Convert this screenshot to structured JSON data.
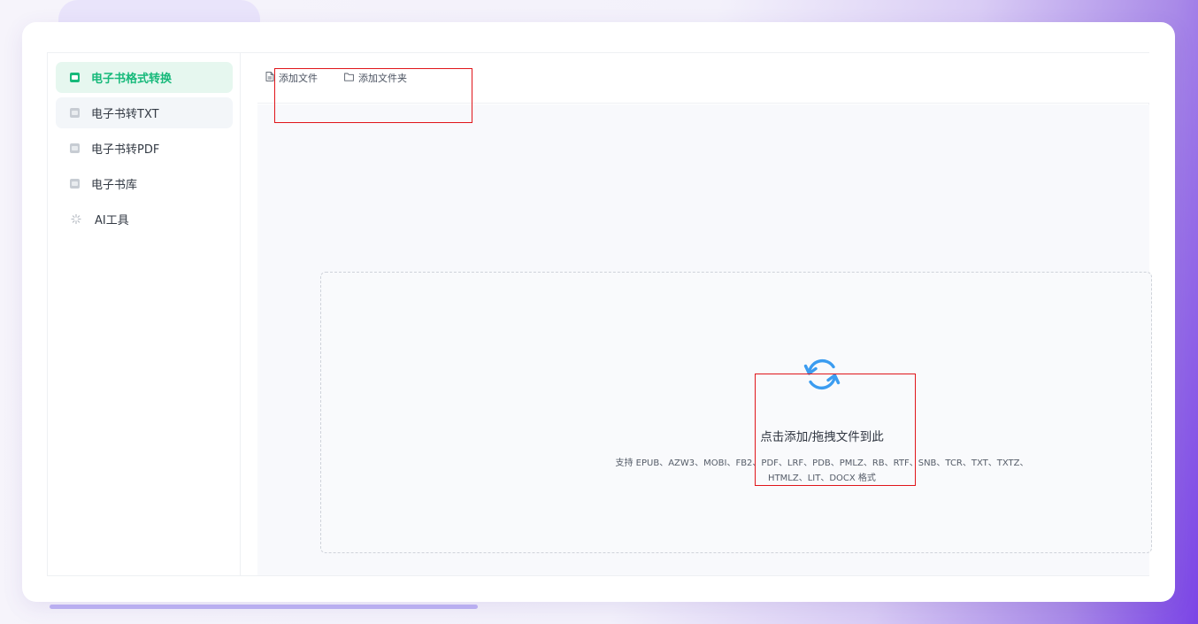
{
  "sidebar": {
    "items": [
      {
        "label": "电子书格式转换",
        "icon": "convert-icon"
      },
      {
        "label": "电子书转TXT",
        "icon": "txt-icon"
      },
      {
        "label": "电子书转PDF",
        "icon": "pdf-icon"
      },
      {
        "label": "电子书库",
        "icon": "library-icon"
      },
      {
        "label": "AI工具",
        "icon": "sparkle-icon"
      }
    ]
  },
  "toolbar": {
    "add_file_label": "添加文件",
    "add_folder_label": "添加文件夹"
  },
  "dropzone": {
    "title": "点击添加/拖拽文件到此",
    "hint": "支持 EPUB、AZW3、MOBI、FB2、PDF、LRF、PDB、PMLZ、RB、RTF、SNB、TCR、TXT、TXTZ、HTMLZ、LIT、DOCX 格式"
  },
  "colors": {
    "accent": "#16b97a",
    "highlight": "#e0151a",
    "refresh_icon": "#3b9cf0"
  }
}
